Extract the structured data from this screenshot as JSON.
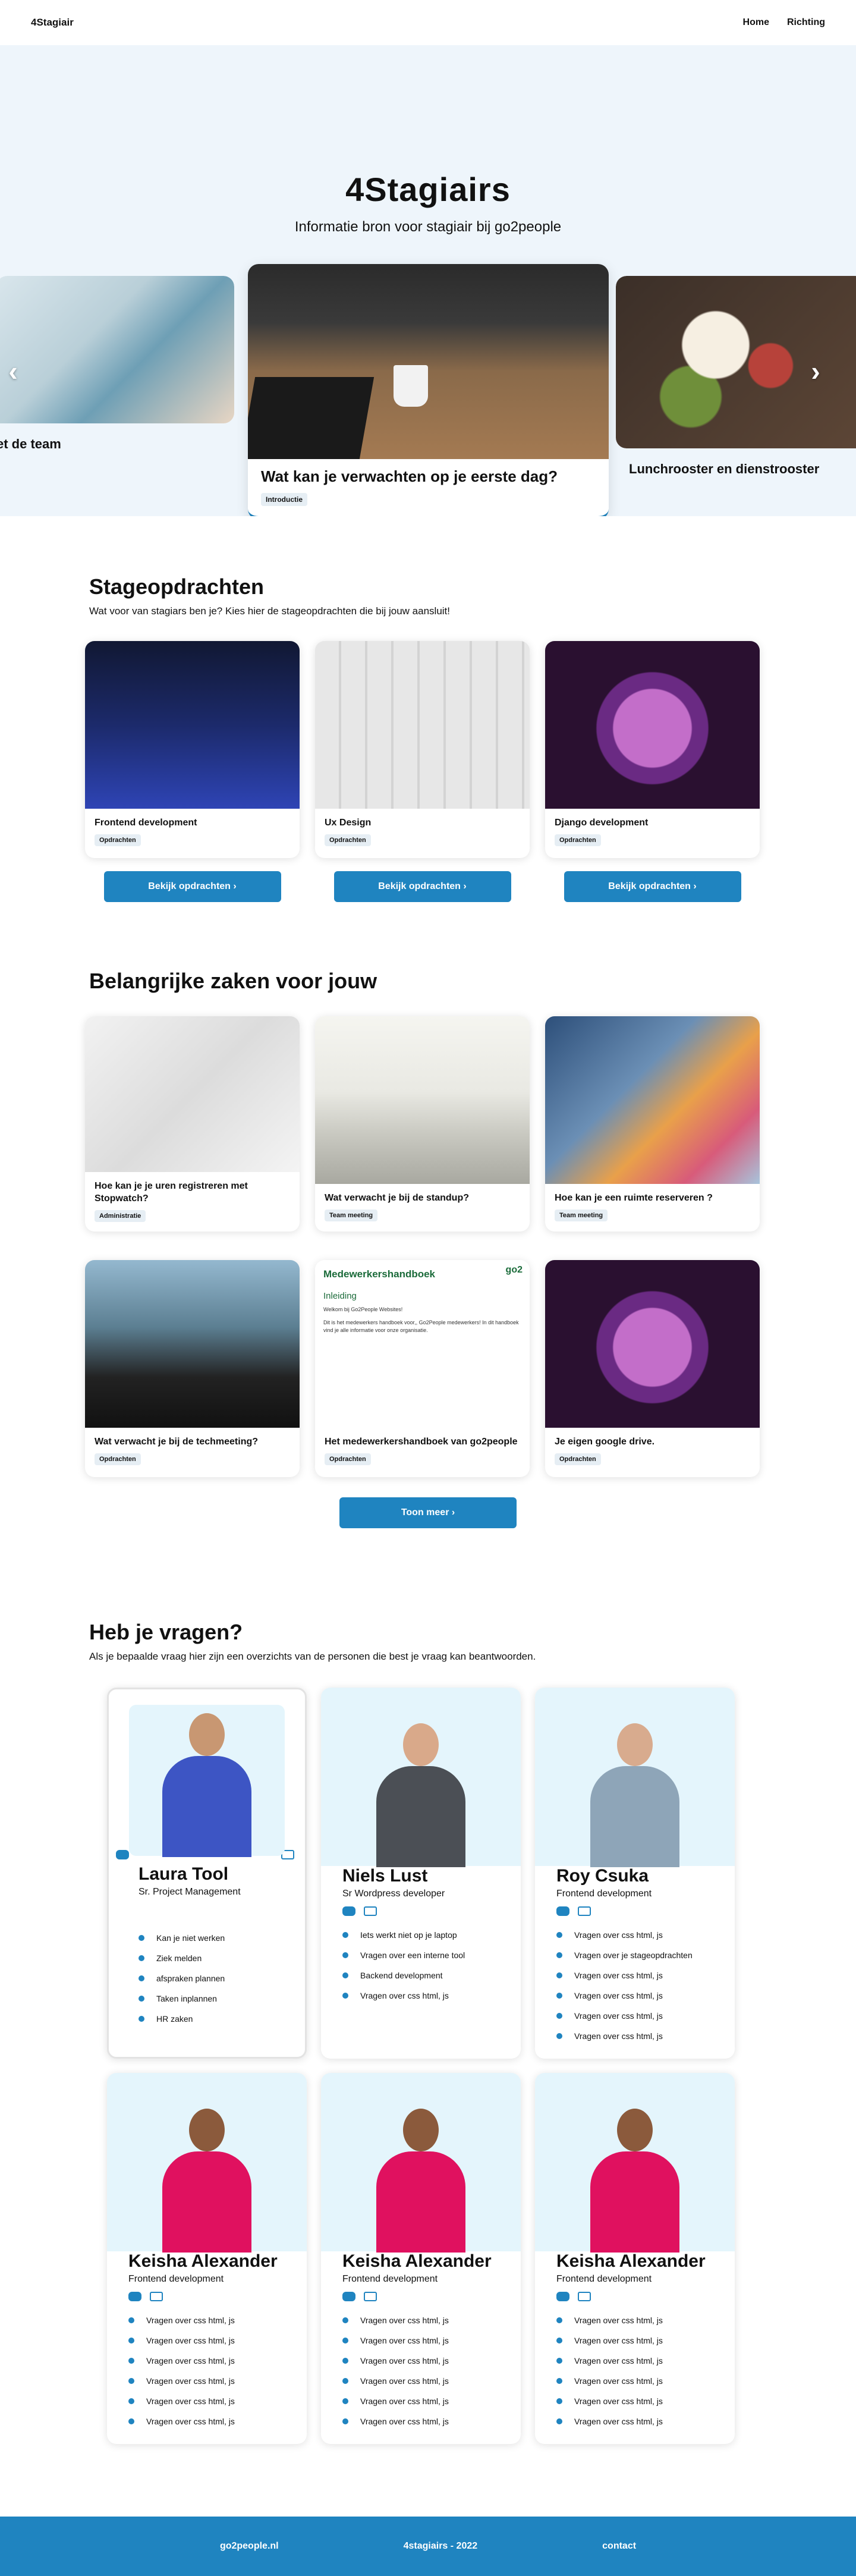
{
  "nav": {
    "logo": "4Stagiair",
    "links": [
      "Home",
      "Richting"
    ]
  },
  "hero": {
    "title": "4Stagiairs",
    "subtitle": "Informatie bron voor stagiair bij go2people",
    "slides": [
      {
        "caption": "et de team"
      },
      {
        "caption": "Wat kan je verwachten op je eerste dag?",
        "tag": "Introductie"
      },
      {
        "caption": "Lunchrooster en dienstrooster"
      }
    ],
    "arrow_left": "‹",
    "arrow_right": "›",
    "dots": 8
  },
  "stage": {
    "title": "Stageopdrachten",
    "subtitle": "Wat voor van stagiars ben je? Kies hier de stageopdrachten die bij jouw aansluit!",
    "cards": [
      {
        "title": "Frontend development",
        "tag": "Opdrachten"
      },
      {
        "title": "Ux Design",
        "tag": "Opdrachten"
      },
      {
        "title": "Django development",
        "tag": "Opdrachten"
      }
    ],
    "button_label": "Bekijk opdrachten  ›"
  },
  "important": {
    "title": "Belangrijke zaken voor jouw",
    "cards": [
      {
        "title": "Hoe kan je je uren registreren met Stopwatch?",
        "tag": "Administratie"
      },
      {
        "title": "Wat verwacht je bij de standup?",
        "tag": "Team meeting"
      },
      {
        "title": "Hoe kan je een ruimte reserveren ?",
        "tag": "Team meeting"
      },
      {
        "title": "Wat verwacht je bij de techmeeting?",
        "tag": "Opdrachten"
      },
      {
        "title": "Het medewerkershandboek van go2people",
        "tag": "Opdrachten"
      },
      {
        "title": "Je eigen google drive.",
        "tag": "Opdrachten"
      }
    ],
    "handbook": {
      "heading": "Medewerkershandboek",
      "logo": "go2",
      "sub": "Inleiding",
      "line1": "Welkom bij Go2People Websites!",
      "line2": "Dit is het medewerkers handboek voor,, Go2People medewerkers! In dit handboek vind je alle informatie voor onze organisatie."
    },
    "more_button": "Toon meer  ›"
  },
  "people": {
    "title": "Heb je vragen?",
    "subtitle": "Als je bepaalde vraag hier zijn een overzichts van de personen die  best je vraag kan beantwoorden.",
    "cards": [
      {
        "name": "Laura Tool",
        "role": "Sr. Project Management",
        "items": [
          "Kan je niet werken",
          "Ziek melden",
          "afspraken plannen",
          "Taken inplannen",
          "HR zaken"
        ]
      },
      {
        "name": "Niels Lust",
        "role": "Sr Wordpress developer",
        "items": [
          "Iets werkt niet op je laptop",
          "Vragen over een interne tool",
          "Backend development",
          "Vragen over css html, js"
        ]
      },
      {
        "name": "Roy Csuka",
        "role": "Frontend development",
        "items": [
          "Vragen over css html, js",
          "Vragen over je stageopdrachten",
          "Vragen over css html, js",
          "Vragen over css html, js",
          "Vragen over css html, js",
          "Vragen over css html, js"
        ]
      },
      {
        "name": "Keisha Alexander",
        "role": "Frontend development",
        "items": [
          "Vragen over css html, js",
          "Vragen over css html, js",
          "Vragen over css html, js",
          "Vragen over css html, js",
          "Vragen over css html, js",
          "Vragen over css html, js"
        ]
      },
      {
        "name": "Keisha Alexander",
        "role": "Frontend development",
        "items": [
          "Vragen over css html, js",
          "Vragen over css html, js",
          "Vragen over css html, js",
          "Vragen over css html, js",
          "Vragen over css html, js",
          "Vragen over css html, js"
        ]
      },
      {
        "name": "Keisha Alexander",
        "role": "Frontend development",
        "items": [
          "Vragen over css html, js",
          "Vragen over css html, js",
          "Vragen over css html, js",
          "Vragen over css html, js",
          "Vragen over css html, js",
          "Vragen over css html, js"
        ]
      }
    ]
  },
  "footer": {
    "links": [
      "go2people.nl",
      "4stagiairs - 2022",
      "contact"
    ]
  },
  "colors": {
    "accent": "#1f84c0",
    "hero_bg": "#eef5fb",
    "person_bg": "#e4f5fc",
    "tag_bg": "#e6eef4"
  }
}
